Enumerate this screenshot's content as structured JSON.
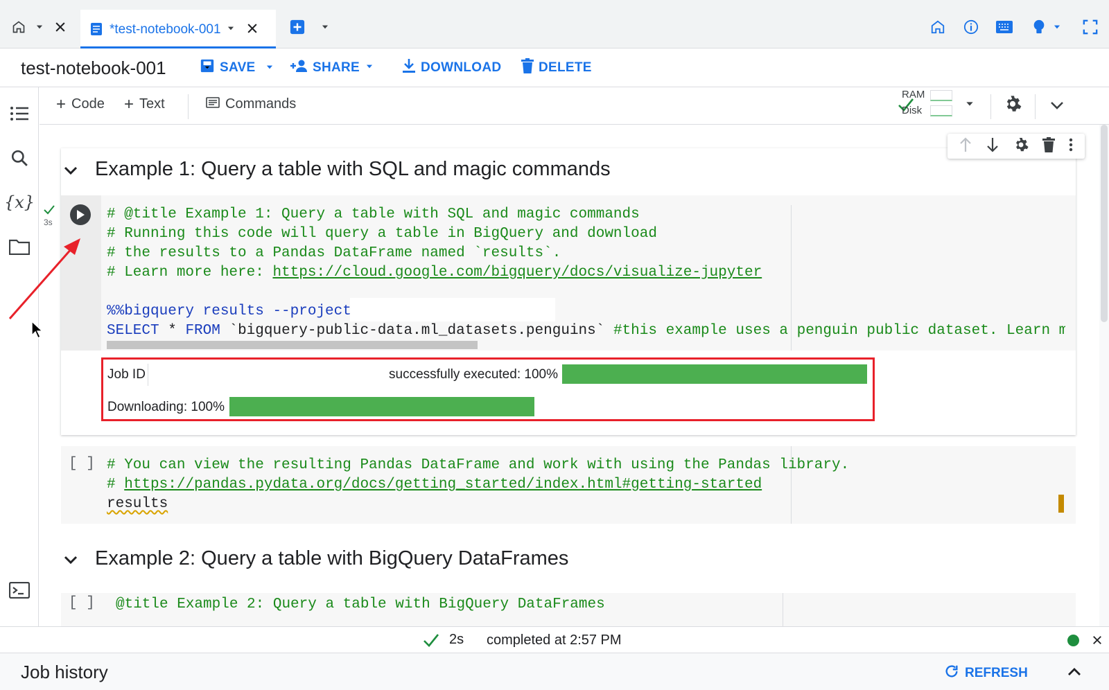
{
  "tabs": [
    {
      "label": "*test-notebook-001",
      "active": true
    }
  ],
  "notebook": {
    "title": "test-notebook-001"
  },
  "actions": {
    "save": "SAVE",
    "share": "SHARE",
    "download": "DOWNLOAD",
    "delete": "DELETE"
  },
  "toolbar": {
    "code": "Code",
    "text": "Text",
    "commands": "Commands",
    "ram": "RAM",
    "disk": "Disk"
  },
  "cells": {
    "heading1": "Example 1: Query a table with SQL and magic commands",
    "exec_mark": "3s",
    "code1": {
      "line1": "# @title Example 1: Query a table with SQL and magic commands",
      "line2": "# Running this code will query a table in BigQuery and download",
      "line3": "# the results to a Pandas DataFrame named `results`.",
      "line4_prefix": "# Learn more here: ",
      "line4_link": "https://cloud.google.com/bigquery/docs/visualize-jupyter",
      "magic": "%%bigquery results --project",
      "sql_select": "SELECT",
      "sql_star": " * ",
      "sql_from": "FROM",
      "sql_table": " `bigquery-public-data.ml_datasets.penguins` ",
      "sql_comment": "#this example uses a penguin public dataset. Learn mor"
    },
    "output": {
      "job_id_label": "Job ID",
      "job_status": "successfully executed: 100%",
      "downloading": "Downloading: 100%",
      "job_progress": 100,
      "download_progress": 100
    },
    "cell2_bracket": "[ ]",
    "code2": {
      "line1": "# You can view the resulting Pandas DataFrame and work with using the Pandas library.",
      "line2_prefix": "# ",
      "line2_link": "https://pandas.pydata.org/docs/getting_started/index.html#getting-started",
      "line3": "results"
    },
    "heading2": "Example 2: Query a table with BigQuery DataFrames",
    "cell3_bracket": "[ ]",
    "code3": {
      "line1": "@title Example 2: Query a table with BigQuery DataFrames"
    }
  },
  "status": {
    "duration": "2s",
    "completed": "completed at 2:57 PM"
  },
  "job_history": {
    "title": "Job history",
    "refresh": "REFRESH"
  },
  "colors": {
    "accent": "#1a73e8",
    "progress": "#4caf50",
    "highlight": "#e8212a",
    "comment": "#1a8a1a"
  }
}
